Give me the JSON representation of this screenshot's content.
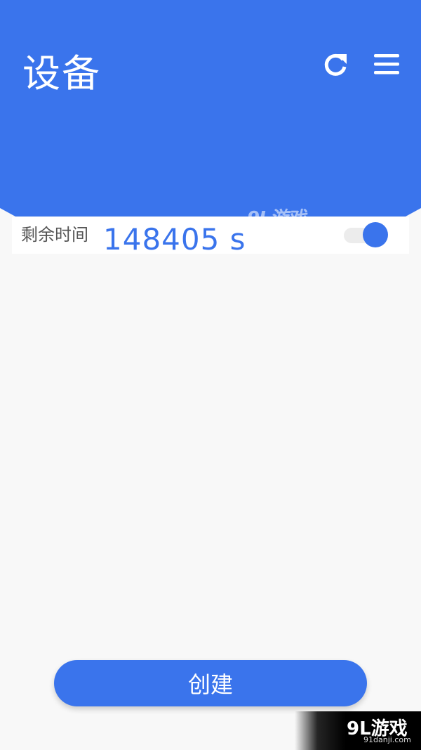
{
  "header": {
    "title": "设备",
    "refresh_icon": "refresh-icon",
    "menu_icon": "menu-icon"
  },
  "timer": {
    "label": "剩余时间",
    "value": "148405 s",
    "toggle_on": true
  },
  "actions": {
    "create_label": "创建"
  },
  "watermark": {
    "logo_text": "9L游戏",
    "site_text": "91danji.com"
  },
  "colors": {
    "primary": "#3a74ec",
    "background": "#f8f8f8",
    "card": "#ffffff",
    "label_text": "#555555"
  }
}
